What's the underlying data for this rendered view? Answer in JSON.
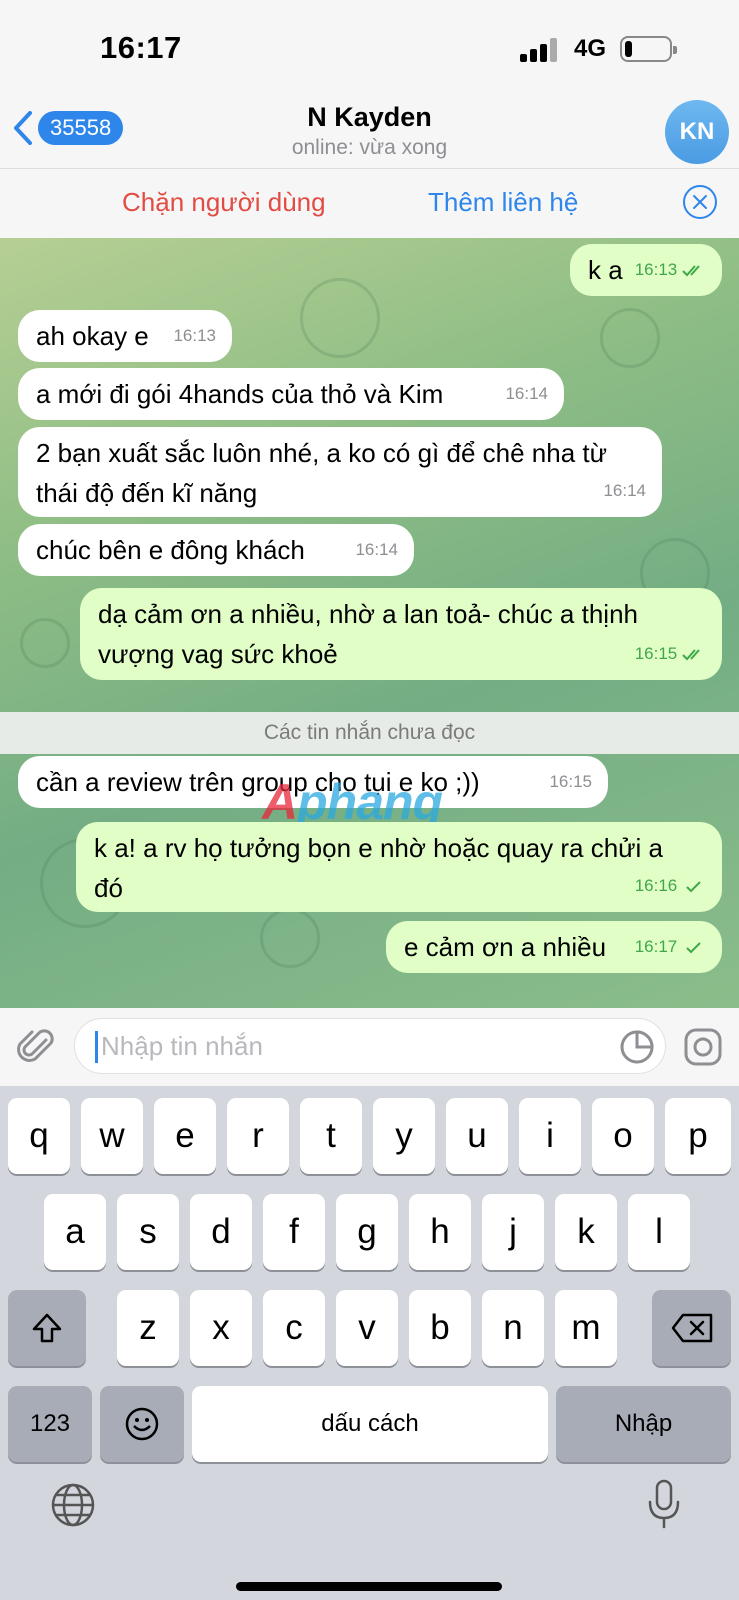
{
  "status": {
    "time": "16:17",
    "network": "4G"
  },
  "header": {
    "unread_count": "35558",
    "title": "N Kayden",
    "subtitle": "online: vừa xong",
    "avatar_initials": "KN"
  },
  "actions": {
    "block": "Chặn người dùng",
    "add_contact": "Thêm liên hệ"
  },
  "messages": [
    {
      "dir": "out",
      "text": "k a",
      "time": "16:13",
      "read": true
    },
    {
      "dir": "in",
      "text": "ah okay e",
      "time": "16:13"
    },
    {
      "dir": "in",
      "text": "a mới đi gói 4hands của thỏ và Kim",
      "time": "16:14"
    },
    {
      "dir": "in",
      "text": "2 bạn xuất sắc luôn nhé, a ko có gì để chê nha từ thái độ đến kĩ năng",
      "time": "16:14"
    },
    {
      "dir": "in",
      "text": "chúc bên e đông khách",
      "time": "16:14"
    },
    {
      "dir": "out",
      "text": "dạ cảm ơn a nhiều, nhờ a lan toả- chúc a thịnh vượng vag sức khoẻ",
      "time": "16:15",
      "read": true
    },
    {
      "dir": "in",
      "text": "cần a review trên group cho tụi e ko ;))",
      "time": "16:15"
    },
    {
      "dir": "out",
      "text": "k a! a rv họ tưởng bọn e nhờ hoặc quay ra chửi a đó",
      "time": "16:16",
      "read": false
    },
    {
      "dir": "out",
      "text": "e cảm ơn a nhiều",
      "time": "16:17",
      "read": false
    }
  ],
  "unread_divider": "Các tin nhắn chưa đọc",
  "watermark": {
    "part1": "A",
    "part2": "phang"
  },
  "composer": {
    "placeholder": "Nhập tin nhắn"
  },
  "keyboard": {
    "row1": [
      "q",
      "w",
      "e",
      "r",
      "t",
      "y",
      "u",
      "i",
      "o",
      "p"
    ],
    "row2": [
      "a",
      "s",
      "d",
      "f",
      "g",
      "h",
      "j",
      "k",
      "l"
    ],
    "row3": [
      "z",
      "x",
      "c",
      "v",
      "b",
      "n",
      "m"
    ],
    "numbers": "123",
    "space": "dấu cách",
    "return": "Nhập"
  },
  "colors": {
    "accent": "#2f86ea",
    "danger": "#e24c43",
    "outgoing_bubble": "#e1fec6",
    "incoming_bubble": "#ffffff"
  },
  "icons": [
    "back-chevron-icon",
    "close-circle-icon",
    "double-check-icon",
    "single-check-icon",
    "attach-icon",
    "sticker-icon",
    "camera-icon",
    "shift-icon",
    "backspace-icon",
    "emoji-icon",
    "globe-icon",
    "microphone-icon"
  ]
}
